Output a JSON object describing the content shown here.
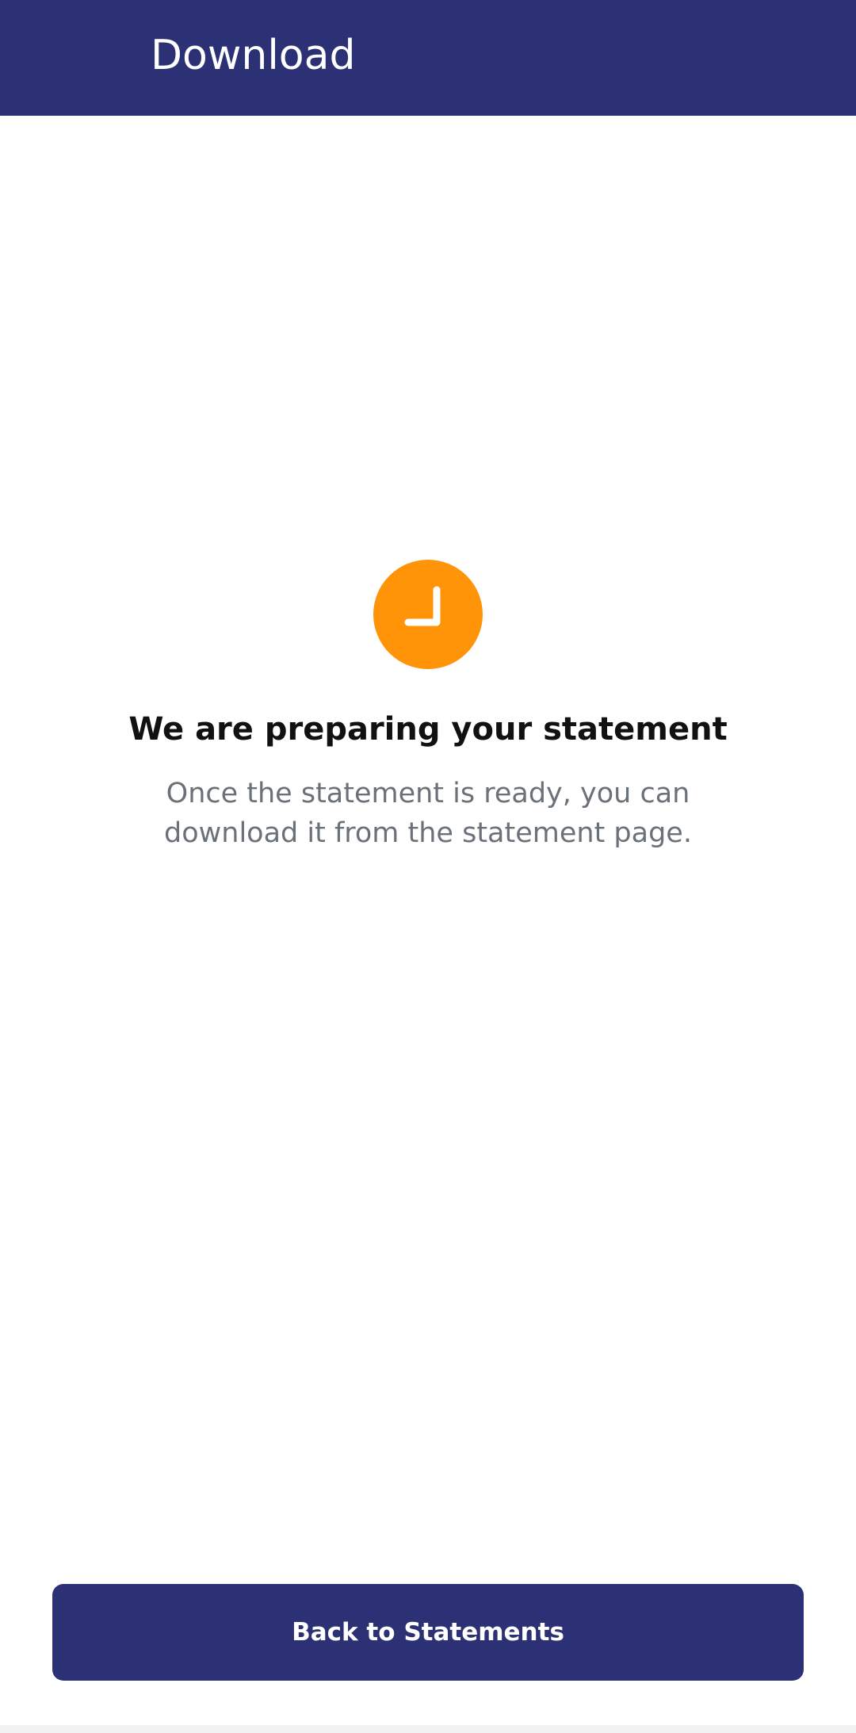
{
  "app_bar": {
    "title": "Download",
    "background": "#2b3174"
  },
  "status": {
    "icon": "clock-icon",
    "icon_color": "#ff9409",
    "headline": "We are preparing your statement",
    "message": "Once the statement is ready, you can download it from the statement page."
  },
  "actions": {
    "back_label": "Back to Statements"
  }
}
